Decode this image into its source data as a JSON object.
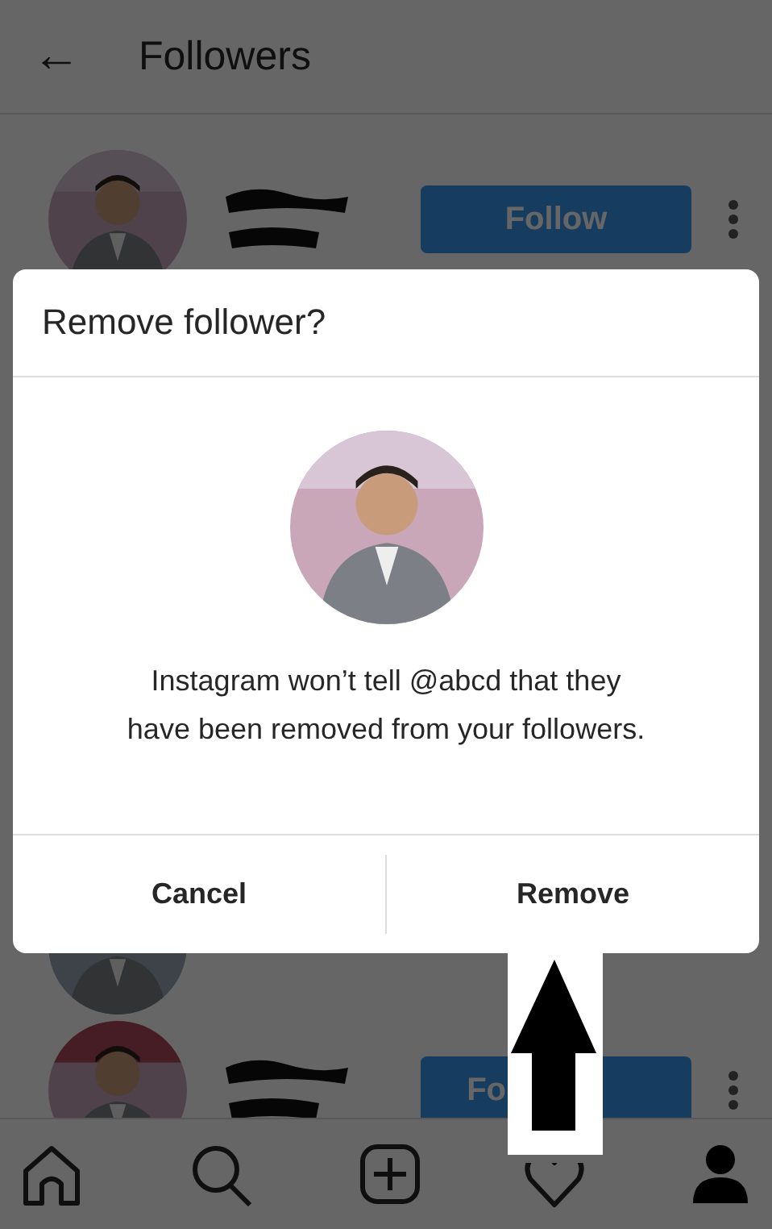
{
  "header": {
    "back_icon": "←",
    "title": "Followers"
  },
  "followers": [
    {
      "kind": "visible",
      "button": "Follow"
    },
    {
      "kind": "spacer"
    },
    {
      "kind": "partial"
    },
    {
      "kind": "covered",
      "button": "Fo"
    }
  ],
  "dialog": {
    "title": "Remove follower?",
    "message": "Instagram won’t tell @abcd that they have been removed from your followers.",
    "buttons": [
      "Cancel",
      "Remove"
    ]
  },
  "nav": [
    {
      "selected": false
    },
    {
      "selected": false
    },
    {
      "selected": false
    },
    {
      "selected": false
    },
    {
      "selected": true
    }
  ]
}
